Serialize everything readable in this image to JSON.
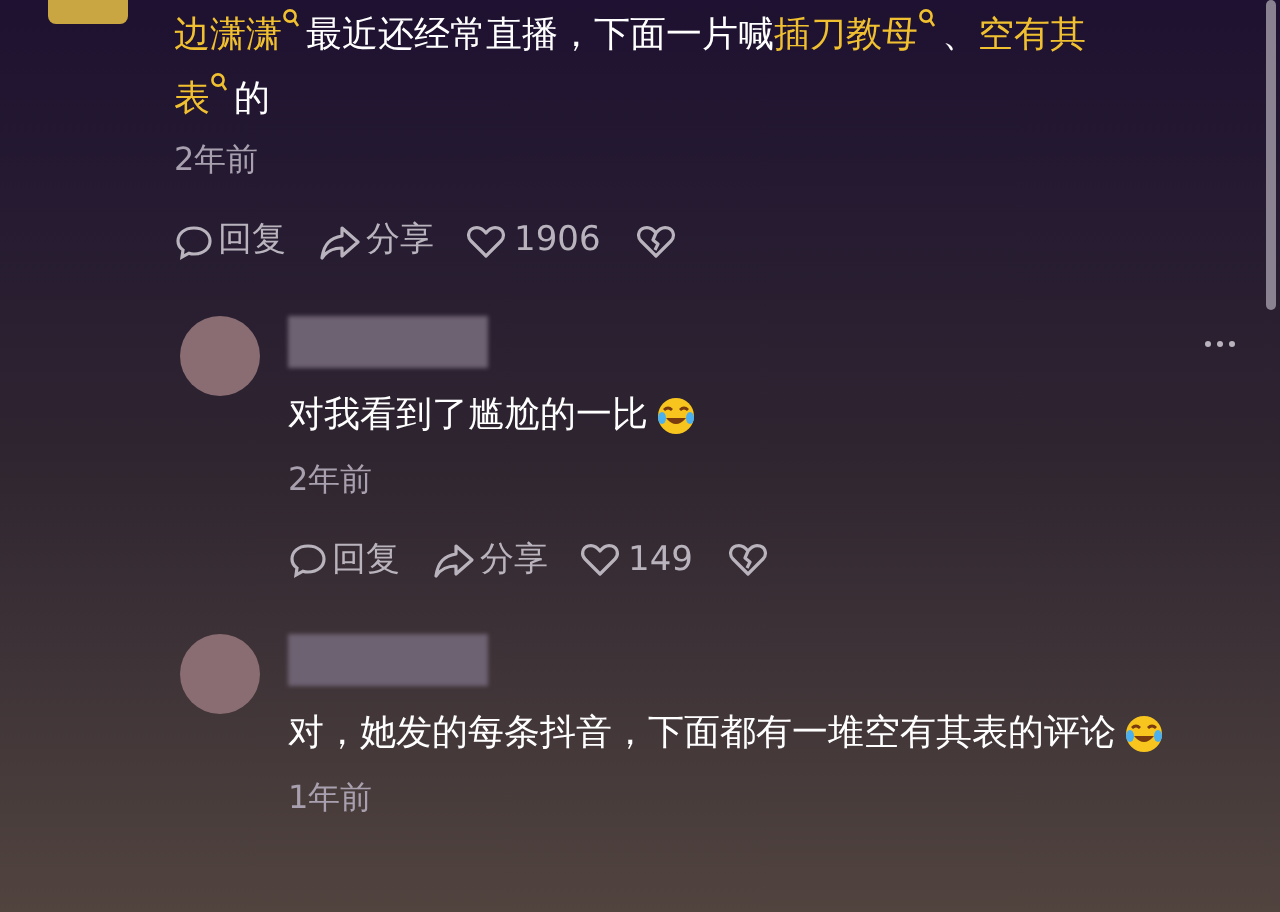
{
  "comments": [
    {
      "segments": [
        {
          "kind": "keyword",
          "text": "边潇潇"
        },
        {
          "kind": "text",
          "text": "最近还经常直播，下面一片喊"
        },
        {
          "kind": "keyword",
          "text": "插刀教母"
        },
        {
          "kind": "text",
          "text": "、"
        },
        {
          "kind": "keyword",
          "text": "空有其表"
        },
        {
          "kind": "text",
          "text": "的"
        }
      ],
      "emoji": false,
      "time": "2年前",
      "reply": "回复",
      "share": "分享",
      "likes": "1906",
      "more": false,
      "reply_level": false
    },
    {
      "segments": [
        {
          "kind": "text",
          "text": "对我看到了尴尬的一比"
        }
      ],
      "emoji": true,
      "time": "2年前",
      "reply": "回复",
      "share": "分享",
      "likes": "149",
      "more": true,
      "reply_level": true
    },
    {
      "segments": [
        {
          "kind": "text",
          "text": "对，她发的每条抖音，下面都有一堆空有其表的评论"
        }
      ],
      "emoji": true,
      "time": "1年前",
      "more": false,
      "reply_level": true
    }
  ]
}
